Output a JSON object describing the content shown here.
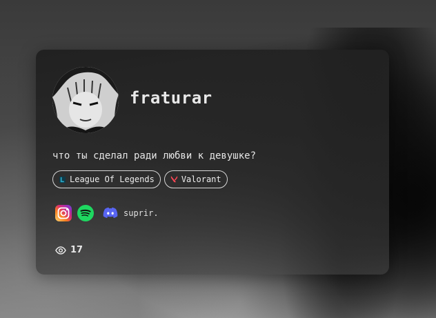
{
  "profile": {
    "username": "fraturar",
    "bio": "что ты сделал ради любви к девушке?",
    "avatar_icon": "manga-portrait-avatar"
  },
  "badges": [
    {
      "label": "League Of Legends",
      "icon": "league-of-legends-icon",
      "color": "#2aa6c4"
    },
    {
      "label": "Valorant",
      "icon": "valorant-icon",
      "color": "#ff4655"
    }
  ],
  "socials": {
    "instagram_icon": "instagram-icon",
    "spotify_icon": "spotify-icon",
    "discord_icon": "discord-icon",
    "discord_name": "suprir.",
    "colors": {
      "spotify": "#1ed760",
      "discord": "#5865f2"
    }
  },
  "stats": {
    "views": "17",
    "views_icon": "eye-icon"
  }
}
